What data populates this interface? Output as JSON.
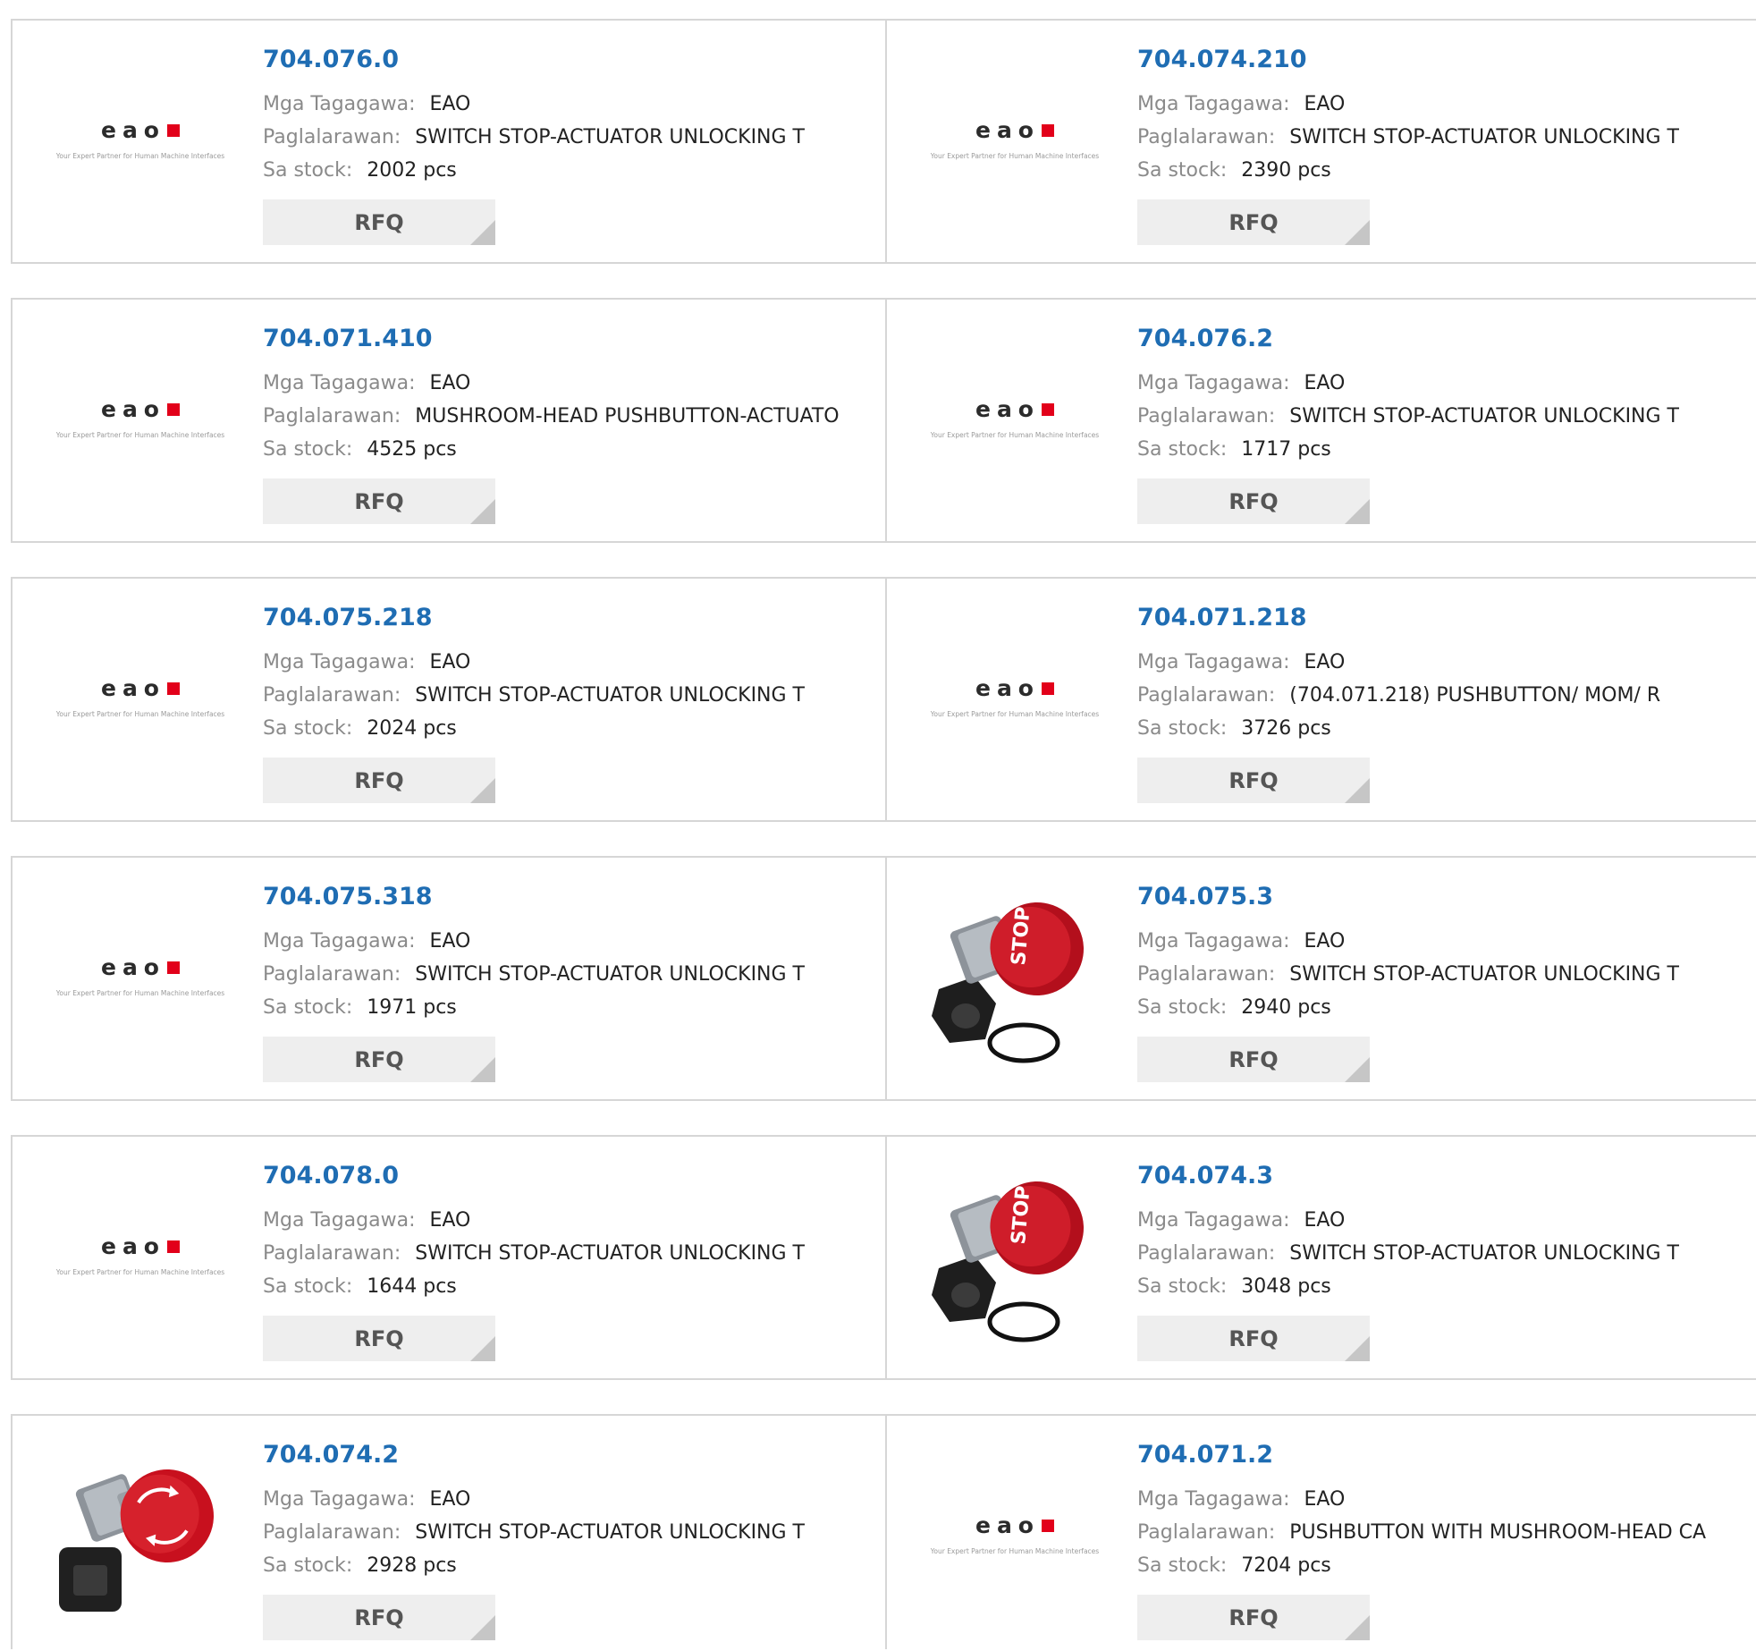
{
  "labels": {
    "manufacturer": "Mga Tagagawa:",
    "description": "Paglalarawan:",
    "stock": "Sa stock:",
    "rfq": "RFQ"
  },
  "logo": {
    "word": "eao",
    "tagline": "Your Expert Partner for Human Machine Interfaces"
  },
  "colors": {
    "part_link": "#1f6db3",
    "logo_red": "#e2001a",
    "button_bg": "#eeeeee",
    "border": "#d6d6d6"
  },
  "products": [
    {
      "part": "704.076.0",
      "manufacturer": "EAO",
      "description": "SWITCH STOP-ACTUATOR UNLOCKING T",
      "stock": "2002 pcs",
      "image": "eao-logo"
    },
    {
      "part": "704.074.210",
      "manufacturer": "EAO",
      "description": "SWITCH STOP-ACTUATOR UNLOCKING T",
      "stock": "2390 pcs",
      "image": "eao-logo"
    },
    {
      "part": "704.071.410",
      "manufacturer": "EAO",
      "description": "MUSHROOM-HEAD PUSHBUTTON-ACTUATO",
      "stock": "4525 pcs",
      "image": "eao-logo"
    },
    {
      "part": "704.076.2",
      "manufacturer": "EAO",
      "description": "SWITCH STOP-ACTUATOR UNLOCKING T",
      "stock": "1717 pcs",
      "image": "eao-logo"
    },
    {
      "part": "704.075.218",
      "manufacturer": "EAO",
      "description": "SWITCH STOP-ACTUATOR UNLOCKING T",
      "stock": "2024 pcs",
      "image": "eao-logo"
    },
    {
      "part": "704.071.218",
      "manufacturer": "EAO",
      "description": "(704.071.218) PUSHBUTTON/ MOM/ R",
      "stock": "3726 pcs",
      "image": "eao-logo"
    },
    {
      "part": "704.075.318",
      "manufacturer": "EAO",
      "description": "SWITCH STOP-ACTUATOR UNLOCKING T",
      "stock": "1971 pcs",
      "image": "eao-logo"
    },
    {
      "part": "704.075.3",
      "manufacturer": "EAO",
      "description": "SWITCH STOP-ACTUATOR UNLOCKING T",
      "stock": "2940 pcs",
      "image": "stop-button-photo"
    },
    {
      "part": "704.078.0",
      "manufacturer": "EAO",
      "description": "SWITCH STOP-ACTUATOR UNLOCKING T",
      "stock": "1644 pcs",
      "image": "eao-logo"
    },
    {
      "part": "704.074.3",
      "manufacturer": "EAO",
      "description": "SWITCH STOP-ACTUATOR UNLOCKING T",
      "stock": "3048 pcs",
      "image": "stop-button-photo"
    },
    {
      "part": "704.074.2",
      "manufacturer": "EAO",
      "description": "SWITCH STOP-ACTUATOR UNLOCKING T",
      "stock": "2928 pcs",
      "image": "emergency-button-photo"
    },
    {
      "part": "704.071.2",
      "manufacturer": "EAO",
      "description": "PUSHBUTTON WITH MUSHROOM-HEAD CA",
      "stock": "7204 pcs",
      "image": "eao-logo"
    }
  ]
}
